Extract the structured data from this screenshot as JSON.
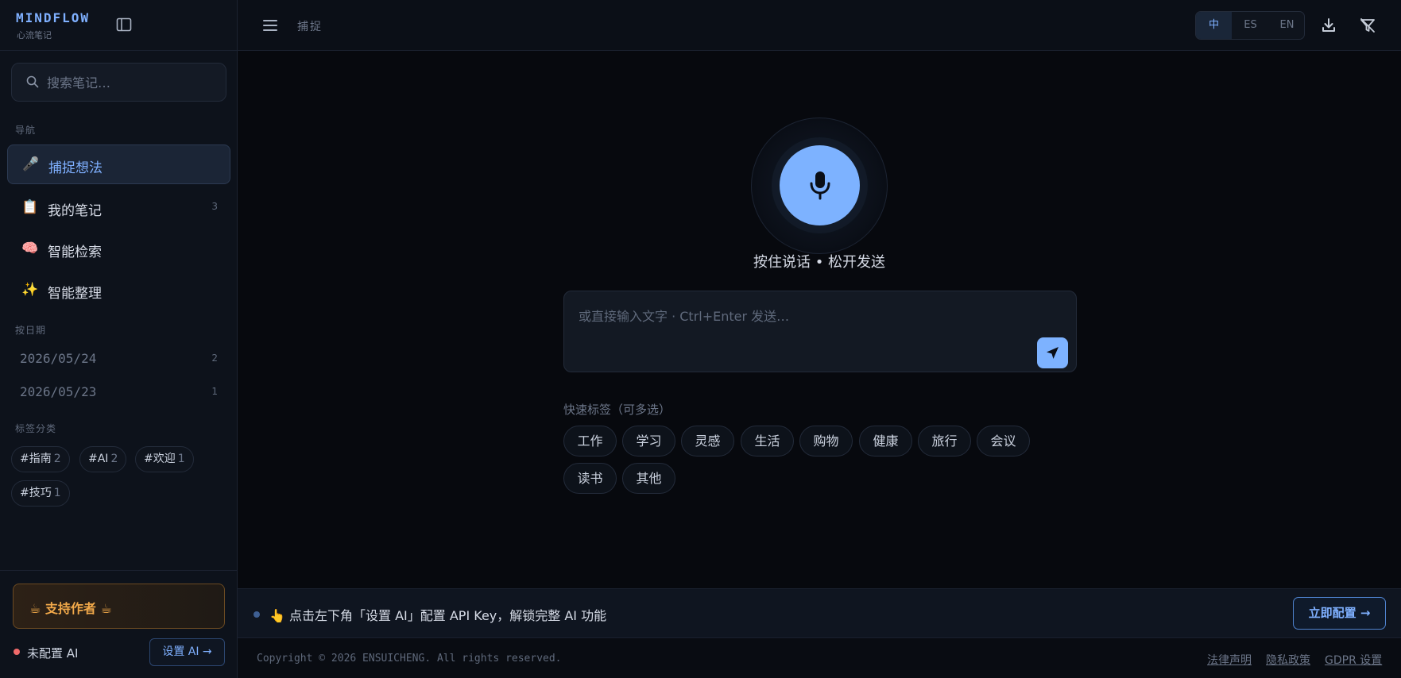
{
  "brand": {
    "name": "MINDFLOW",
    "subtitle": "心流笔记"
  },
  "search": {
    "placeholder": "搜索笔记…"
  },
  "sidebar": {
    "nav_label": "导航",
    "nav_items": [
      {
        "icon": "🎤",
        "label": "捕捉想法",
        "count": "",
        "active": true
      },
      {
        "icon": "📋",
        "label": "我的笔记",
        "count": "3"
      },
      {
        "icon": "🧠",
        "label": "智能检索",
        "count": ""
      },
      {
        "icon": "✨",
        "label": "智能整理",
        "count": ""
      }
    ],
    "date_label": "按日期",
    "dates": [
      {
        "label": "2026/05/24",
        "count": "2"
      },
      {
        "label": "2026/05/23",
        "count": "1"
      }
    ],
    "tags_label": "标签分类",
    "tags": [
      {
        "label": "#指南",
        "count": "2"
      },
      {
        "label": "#AI",
        "count": "2"
      },
      {
        "label": "#欢迎",
        "count": "1"
      },
      {
        "label": "#技巧",
        "count": "1"
      }
    ],
    "support_label": "☕  支持作者 ☕",
    "ai_status": "未配置 AI",
    "setup_ai_label": "设置 AI →"
  },
  "topbar": {
    "breadcrumb": "捕捉",
    "languages": [
      {
        "label": "中",
        "active": true
      },
      {
        "label": "ES"
      },
      {
        "label": "EN"
      }
    ]
  },
  "capture": {
    "mic_hint": "按住说话 • 松开发送",
    "input_placeholder": "或直接输入文字 · Ctrl+Enter 发送…",
    "quick_tags_label": "快速标签（可多选）",
    "quick_tags": [
      "工作",
      "学习",
      "灵感",
      "生活",
      "购物",
      "健康",
      "旅行",
      "会议",
      "读书",
      "其他"
    ]
  },
  "banner": {
    "text": "👆 点击左下角「设置 AI」配置 API Key，解锁完整 AI 功能",
    "button": "立即配置 →"
  },
  "footer": {
    "copyright": "Copyright © 2026 ENSUICHENG. All rights reserved.",
    "links": [
      "法律声明",
      "隐私政策",
      "GDPR 设置"
    ]
  },
  "colors": {
    "accent": "#7db2ff",
    "background": "#07090e",
    "sidebar": "#0d121b",
    "warning": "#f2a94a",
    "status_off": "#f06a6a"
  }
}
